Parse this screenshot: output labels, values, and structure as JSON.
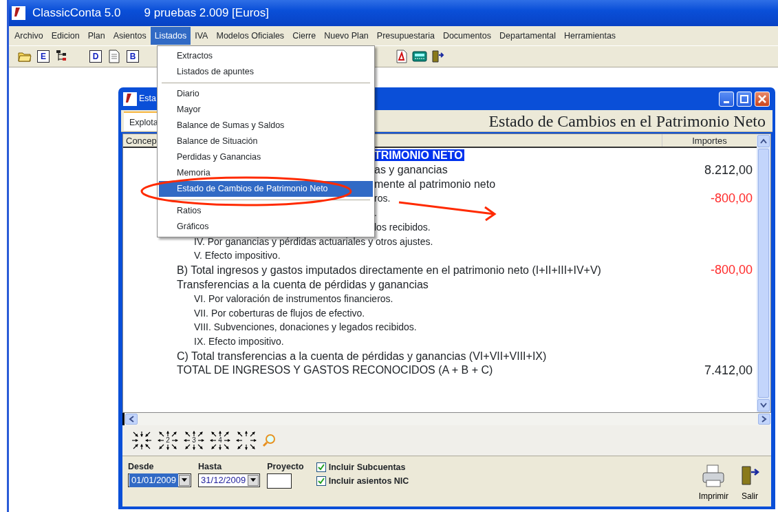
{
  "app": {
    "title": "ClassicConta 5.0",
    "subtitle": "9 pruebas 2.009 [Euros]"
  },
  "menubar": [
    {
      "label": "Archivo",
      "selected": false
    },
    {
      "label": "Edicion",
      "selected": false
    },
    {
      "label": "Plan",
      "selected": false
    },
    {
      "label": "Asientos",
      "selected": false
    },
    {
      "label": "Listados",
      "selected": true
    },
    {
      "label": "IVA",
      "selected": false
    },
    {
      "label": "Modelos Oficiales",
      "selected": false
    },
    {
      "label": "Cierre",
      "selected": false
    },
    {
      "label": "Nuevo Plan",
      "selected": false
    },
    {
      "label": "Presupuestaria",
      "selected": false
    },
    {
      "label": "Documentos",
      "selected": false
    },
    {
      "label": "Departamental",
      "selected": false
    },
    {
      "label": "Herramientas",
      "selected": false
    }
  ],
  "toolbar": [
    {
      "kind": "folder"
    },
    {
      "kind": "letter",
      "label": "E"
    },
    {
      "kind": "tree"
    },
    {
      "kind": "gap"
    },
    {
      "kind": "letter",
      "label": "D"
    },
    {
      "kind": "page"
    },
    {
      "kind": "letter",
      "label": "B"
    },
    {
      "kind": "hidden"
    },
    {
      "kind": "pdf"
    },
    {
      "kind": "calc"
    },
    {
      "kind": "exit"
    }
  ],
  "dropdown": {
    "groups": [
      [
        {
          "label": "Extractos",
          "selected": false
        },
        {
          "label": "Listados de apuntes",
          "selected": false
        }
      ],
      [
        {
          "label": "Diario",
          "selected": false
        },
        {
          "label": "Mayor",
          "selected": false
        },
        {
          "label": "Balance de Sumas y Saldos",
          "selected": false
        },
        {
          "label": "Balance de Situación",
          "selected": false
        },
        {
          "label": "Perdidas y Ganancias",
          "selected": false
        },
        {
          "label": "Memoria",
          "selected": false
        },
        {
          "label": "Estado de Cambios de Patrimonio Neto",
          "selected": true
        }
      ],
      [
        {
          "label": "Ratios",
          "selected": false
        },
        {
          "label": "Gráficos",
          "selected": false
        }
      ]
    ]
  },
  "window": {
    "title": "Esta",
    "tab": "Explota",
    "report_title": "Estado de Cambios en el Patrimonio Neto",
    "columns": [
      "Concep",
      "Importes"
    ],
    "lines": [
      {
        "kind": "headingclipped",
        "text": "TRIMONIO NETO"
      },
      {
        "kind": "mainclipped",
        "text": "as y ganancias",
        "amount": {
          "value": "8.212,00",
          "negative": false
        }
      },
      {
        "kind": "mainclipped",
        "text": "mente al patrimonio neto"
      },
      {
        "kind": "subclipped",
        "text": "ros.",
        "amount": {
          "value": "-800,00",
          "negative": true
        }
      },
      {
        "kind": "subclipped",
        "text": "."
      },
      {
        "kind": "subclipped",
        "text": "los recibidos."
      },
      {
        "kind": "sub",
        "text": "IV. Por ganancias y pérdidas actuariales y otros ajustes."
      },
      {
        "kind": "sub",
        "text": "V. Efecto impositivo."
      },
      {
        "kind": "main",
        "text": "B) Total ingresos y gastos imputados directamente en el patrimonio neto (I+II+III+IV+V)",
        "amount": {
          "value": "-800,00",
          "negative": true
        }
      },
      {
        "kind": "main",
        "text": "Transferencias a la cuenta de pérdidas y ganancias"
      },
      {
        "kind": "sub",
        "text": "VI. Por valoración de instrumentos financieros."
      },
      {
        "kind": "sub",
        "text": "VII. Por coberturas de flujos de efectivo."
      },
      {
        "kind": "sub",
        "text": "VIII. Subvenciones, donaciones y legados recibidos."
      },
      {
        "kind": "sub",
        "text": "IX. Efecto impositivo."
      },
      {
        "kind": "main",
        "text": "C) Total transferencias a la cuenta de pérdidas y ganancias (VI+VII+VIII+IX)"
      },
      {
        "kind": "main",
        "text": "TOTAL DE INGRESOS Y GASTOS RECONOCIDOS (A + B + C)",
        "amount": {
          "value": "7.412,00",
          "negative": false
        }
      }
    ],
    "zoom_buttons": [
      {
        "kind": "inward"
      },
      {
        "kind": "outward",
        "label": "2"
      },
      {
        "kind": "outward",
        "label": "3"
      },
      {
        "kind": "outward",
        "label": "4"
      },
      {
        "kind": "outward"
      }
    ],
    "filters": {
      "desde": {
        "label": "Desde",
        "value": "01/01/2009"
      },
      "hasta": {
        "label": "Hasta",
        "value": "31/12/2009"
      },
      "proyecto": {
        "label": "Proyecto"
      },
      "checks": [
        {
          "label": "Incluir Subcuentas",
          "checked": true
        },
        {
          "label": "Incluir asientos NIC",
          "checked": true
        }
      ]
    },
    "actions": [
      {
        "kind": "print",
        "label": "Imprimir"
      },
      {
        "kind": "exit",
        "label": "Salir"
      }
    ]
  }
}
